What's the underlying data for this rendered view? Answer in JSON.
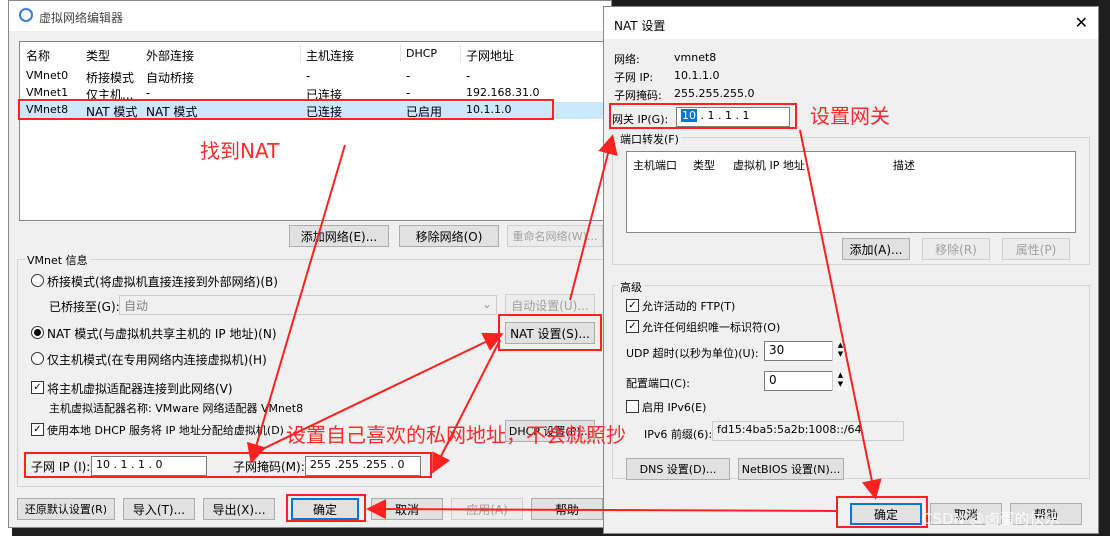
{
  "left_dialog": {
    "title": "虚拟网络编辑器",
    "columns": [
      "名称",
      "类型",
      "外部连接",
      "主机连接",
      "DHCP",
      "子网地址"
    ],
    "rows": [
      [
        "VMnet0",
        "桥接模式",
        "自动桥接",
        "-",
        "-",
        "-"
      ],
      [
        "VMnet1",
        "仅主机...",
        "-",
        "已连接",
        "-",
        "192.168.31.0"
      ],
      [
        "VMnet8",
        "NAT 模式",
        "NAT 模式",
        "已连接",
        "已启用",
        "10.1.1.0"
      ]
    ],
    "add_network": "添加网络(E)...",
    "remove_network": "移除网络(O)",
    "rename_network": "重命名网络(W)...",
    "vmnet_info": "VMnet 信息",
    "bridge_mode": "桥接模式(将虚拟机直接连接到外部网络)(B)",
    "bridged_to_label": "已桥接至(G):",
    "bridged_to_value": "自动",
    "auto_settings": "自动设置(U)...",
    "nat_mode": "NAT 模式(与虚拟机共享主机的 IP 地址)(N)",
    "nat_settings": "NAT 设置(S)...",
    "host_only": "仅主机模式(在专用网络内连接虚拟机)(H)",
    "connect_adapter": "将主机虚拟适配器连接到此网络(V)",
    "adapter_name": "主机虚拟适配器名称: VMware 网络适配器 VMnet8",
    "use_dhcp": "使用本地 DHCP 服务将 IP 地址分配给虚拟机(D)",
    "dhcp_settings": "DHCP 设置(P)...",
    "subnet_ip_label": "子网 IP (I):",
    "subnet_ip_value": "10 . 1 . 1 . 0",
    "subnet_mask_label": "子网掩码(M):",
    "subnet_mask_value": "255 .255 .255 . 0",
    "restore": "还原默认设置(R)",
    "import": "导入(T)...",
    "export": "导出(X)...",
    "ok": "确定",
    "cancel": "取消",
    "apply": "应用(A)",
    "help": "帮助"
  },
  "nat_dialog": {
    "title": "NAT 设置",
    "network_label": "网络:",
    "network_value": "vmnet8",
    "subnet_ip_label": "子网 IP:",
    "subnet_ip_value": "10.1.1.0",
    "subnet_mask_label": "子网掩码:",
    "subnet_mask_value": "255.255.255.0",
    "gateway_label": "网关 IP(G):",
    "gateway_first": "10",
    "gateway_rest": " .  1  .  1  .  1",
    "port_forwarding": "端口转发(F)",
    "pf_columns": [
      "主机端口",
      "类型",
      "虚拟机 IP 地址",
      "描述"
    ],
    "add": "添加(A)...",
    "remove": "移除(R)",
    "properties": "属性(P)",
    "advanced": "高级",
    "allow_ftp": "允许活动的 FTP(T)",
    "allow_org": "允许任何组织唯一标识符(O)",
    "udp_label": "UDP 超时(以秒为单位)(U):",
    "udp_value": "30",
    "config_port_label": "配置端口(C):",
    "config_port_value": "0",
    "enable_ipv6": "启用 IPv6(E)",
    "ipv6_prefix_label": "IPv6 前缀(6):",
    "ipv6_prefix_value": "fd15:4ba5:5a2b:1008::/64",
    "dns": "DNS 设置(D)...",
    "netbios": "NetBIOS 设置(N)...",
    "ok": "确定",
    "cancel": "取消",
    "help": "帮助"
  },
  "annotations": {
    "find_nat": "找到NAT",
    "set_gateway": "设置网关",
    "set_private": "设置自己喜欢的私网地址，不会就照抄"
  },
  "watermark": "CSDN @卤蛋的快乐",
  "colors": {
    "annotation": "#ff2a2a",
    "selection": "#0078d7"
  }
}
